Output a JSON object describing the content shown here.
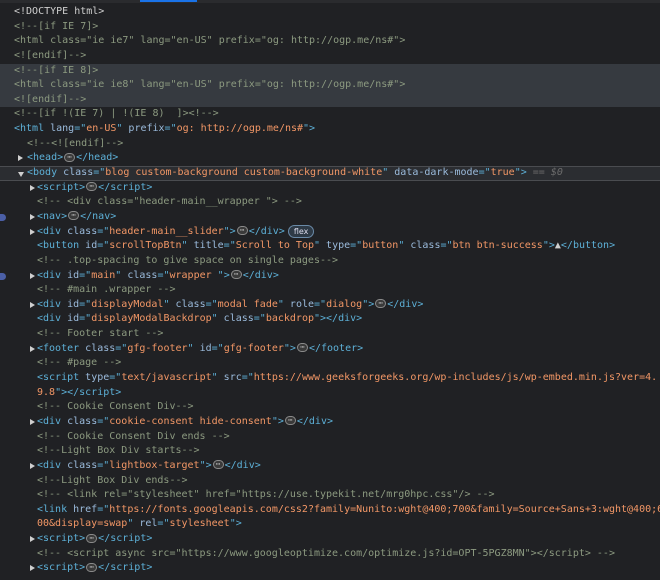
{
  "devtools": {
    "panel": "Elements",
    "selected_suffix": "== $0",
    "rows": [
      {
        "indent": 0,
        "tokens": [
          [
            "tx",
            "<!DOCTYPE html>"
          ]
        ]
      },
      {
        "indent": 0,
        "tokens": [
          [
            "cm",
            "<!--[if IE 7]>"
          ]
        ]
      },
      {
        "indent": 0,
        "tokens": [
          [
            "cm",
            "<html class=\"ie ie7\" lang=\"en-US\" prefix=\"og: http://ogp.me/ns#\">"
          ]
        ]
      },
      {
        "indent": 0,
        "tokens": [
          [
            "cm",
            "<![endif]-->"
          ]
        ]
      },
      {
        "indent": 0,
        "hl": true,
        "tokens": [
          [
            "cm",
            "<!--[if IE 8]>"
          ]
        ]
      },
      {
        "indent": 0,
        "hl": true,
        "tokens": [
          [
            "cm",
            "<html class=\"ie ie8\" lang=\"en-US\" prefix=\"og: http://ogp.me/ns#\">"
          ]
        ]
      },
      {
        "indent": 0,
        "hl": true,
        "tokens": [
          [
            "cm",
            "<![endif]-->"
          ]
        ]
      },
      {
        "indent": 0,
        "tokens": [
          [
            "cm",
            "<!--[if !(IE 7) | !(IE 8)  ]><!-->"
          ]
        ]
      },
      {
        "indent": 0,
        "tokens": [
          [
            "tag",
            "<html "
          ],
          [
            "an",
            "lang"
          ],
          [
            "tag",
            "=\""
          ],
          [
            "av",
            "en-US"
          ],
          [
            "tag",
            "\" "
          ],
          [
            "an",
            "prefix"
          ],
          [
            "tag",
            "=\""
          ],
          [
            "av",
            "og: http://ogp.me/ns#"
          ],
          [
            "tag",
            "\">"
          ]
        ]
      },
      {
        "indent": 1,
        "tokens": [
          [
            "cm",
            "<!--<![endif]-->"
          ]
        ]
      },
      {
        "indent": 1,
        "arrow": "closed",
        "tokens": [
          [
            "tag",
            "<head>"
          ],
          [
            "ell",
            ""
          ],
          [
            "tag",
            "</head>"
          ]
        ]
      },
      {
        "indent": 1,
        "arrow": "open",
        "sel": true,
        "tokens": [
          [
            "tag",
            "<body "
          ],
          [
            "an",
            "class"
          ],
          [
            "tag",
            "=\""
          ],
          [
            "av",
            "blog custom-background custom-background-white"
          ],
          [
            "tag",
            "\" "
          ],
          [
            "an",
            "data-dark-mode"
          ],
          [
            "tag",
            "=\""
          ],
          [
            "av",
            "true"
          ],
          [
            "tag",
            "\">"
          ],
          [
            "dim",
            " == $0"
          ]
        ]
      },
      {
        "indent": 2,
        "arrow": "closed",
        "tokens": [
          [
            "tag",
            "<script>"
          ],
          [
            "ell",
            ""
          ],
          [
            "tag",
            "</script>"
          ]
        ]
      },
      {
        "indent": 2,
        "tokens": [
          [
            "cm",
            "<!-- <div class=\"header-main__wrapper \"> -->"
          ]
        ]
      },
      {
        "indent": 2,
        "arrow": "closed",
        "bp": true,
        "tokens": [
          [
            "tag",
            "<nav>"
          ],
          [
            "ell",
            ""
          ],
          [
            "tag",
            "</nav>"
          ]
        ]
      },
      {
        "indent": 2,
        "arrow": "closed",
        "tokens": [
          [
            "tag",
            "<div "
          ],
          [
            "an",
            "class"
          ],
          [
            "tag",
            "=\""
          ],
          [
            "av",
            "header-main__slider"
          ],
          [
            "tag",
            "\">"
          ],
          [
            "ell",
            ""
          ],
          [
            "tag",
            "</div>"
          ],
          [
            "badge",
            "flex"
          ]
        ]
      },
      {
        "indent": 2,
        "tokens": [
          [
            "tag",
            "<button "
          ],
          [
            "an",
            "id"
          ],
          [
            "tag",
            "=\""
          ],
          [
            "av",
            "scrollTopBtn"
          ],
          [
            "tag",
            "\" "
          ],
          [
            "an",
            "title"
          ],
          [
            "tag",
            "=\""
          ],
          [
            "av",
            "Scroll to Top"
          ],
          [
            "tag",
            "\" "
          ],
          [
            "an",
            "type"
          ],
          [
            "tag",
            "=\""
          ],
          [
            "av",
            "button"
          ],
          [
            "tag",
            "\" "
          ],
          [
            "an",
            "class"
          ],
          [
            "tag",
            "=\""
          ],
          [
            "av",
            "btn btn-success"
          ],
          [
            "tag",
            "\">"
          ],
          [
            "tx",
            "▲"
          ],
          [
            "tag",
            "</button>"
          ]
        ]
      },
      {
        "indent": 2,
        "tokens": [
          [
            "cm",
            "<!-- .top-spacing to give space on single pages-->"
          ]
        ]
      },
      {
        "indent": 2,
        "arrow": "closed",
        "bp": true,
        "tokens": [
          [
            "tag",
            "<div "
          ],
          [
            "an",
            "id"
          ],
          [
            "tag",
            "=\""
          ],
          [
            "av",
            "main"
          ],
          [
            "tag",
            "\" "
          ],
          [
            "an",
            "class"
          ],
          [
            "tag",
            "=\""
          ],
          [
            "av",
            "wrapper "
          ],
          [
            "tag",
            "\">"
          ],
          [
            "ell",
            ""
          ],
          [
            "tag",
            "</div>"
          ]
        ]
      },
      {
        "indent": 2,
        "tokens": [
          [
            "cm",
            "<!-- #main .wrapper -->"
          ]
        ]
      },
      {
        "indent": 2,
        "arrow": "closed",
        "tokens": [
          [
            "tag",
            "<div "
          ],
          [
            "an",
            "id"
          ],
          [
            "tag",
            "=\""
          ],
          [
            "av",
            "displayModal"
          ],
          [
            "tag",
            "\" "
          ],
          [
            "an",
            "class"
          ],
          [
            "tag",
            "=\""
          ],
          [
            "av",
            "modal fade"
          ],
          [
            "tag",
            "\" "
          ],
          [
            "an",
            "role"
          ],
          [
            "tag",
            "=\""
          ],
          [
            "av",
            "dialog"
          ],
          [
            "tag",
            "\">"
          ],
          [
            "ell",
            ""
          ],
          [
            "tag",
            "</div>"
          ]
        ]
      },
      {
        "indent": 2,
        "tokens": [
          [
            "tag",
            "<div "
          ],
          [
            "an",
            "id"
          ],
          [
            "tag",
            "=\""
          ],
          [
            "av",
            "displayModalBackdrop"
          ],
          [
            "tag",
            "\" "
          ],
          [
            "an",
            "class"
          ],
          [
            "tag",
            "=\""
          ],
          [
            "av",
            "backdrop"
          ],
          [
            "tag",
            "\"></div>"
          ]
        ]
      },
      {
        "indent": 2,
        "tokens": [
          [
            "cm",
            "<!-- Footer start -->"
          ]
        ]
      },
      {
        "indent": 2,
        "arrow": "closed",
        "tokens": [
          [
            "tag",
            "<footer "
          ],
          [
            "an",
            "class"
          ],
          [
            "tag",
            "=\""
          ],
          [
            "av",
            "gfg-footer"
          ],
          [
            "tag",
            "\" "
          ],
          [
            "an",
            "id"
          ],
          [
            "tag",
            "=\""
          ],
          [
            "av",
            "gfg-footer"
          ],
          [
            "tag",
            "\">"
          ],
          [
            "ell",
            ""
          ],
          [
            "tag",
            "</footer>"
          ]
        ]
      },
      {
        "indent": 2,
        "tokens": [
          [
            "cm",
            "<!-- #page -->"
          ]
        ]
      },
      {
        "indent": 2,
        "tokens": [
          [
            "tag",
            "<script "
          ],
          [
            "an",
            "type"
          ],
          [
            "tag",
            "=\""
          ],
          [
            "av",
            "text/javascript"
          ],
          [
            "tag",
            "\" "
          ],
          [
            "an",
            "src"
          ],
          [
            "tag",
            "=\""
          ],
          [
            "av",
            "https://www.geeksforgeeks.org/wp-includes/js/wp-embed.min.js?ver=4."
          ]
        ]
      },
      {
        "indent": 2,
        "tokens": [
          [
            "av",
            "9.8"
          ],
          [
            "tag",
            "\"></script>"
          ]
        ]
      },
      {
        "indent": 2,
        "tokens": [
          [
            "cm",
            "<!-- Cookie Consent Div-->"
          ]
        ]
      },
      {
        "indent": 2,
        "arrow": "closed",
        "tokens": [
          [
            "tag",
            "<div "
          ],
          [
            "an",
            "class"
          ],
          [
            "tag",
            "=\""
          ],
          [
            "av",
            "cookie-consent hide-consent"
          ],
          [
            "tag",
            "\">"
          ],
          [
            "ell",
            ""
          ],
          [
            "tag",
            "</div>"
          ]
        ]
      },
      {
        "indent": 2,
        "tokens": [
          [
            "cm",
            "<!-- Cookie Consent Div ends -->"
          ]
        ]
      },
      {
        "indent": 2,
        "tokens": [
          [
            "cm",
            "<!--Light Box Div starts-->"
          ]
        ]
      },
      {
        "indent": 2,
        "arrow": "closed",
        "tokens": [
          [
            "tag",
            "<div "
          ],
          [
            "an",
            "class"
          ],
          [
            "tag",
            "=\""
          ],
          [
            "av",
            "lightbox-target"
          ],
          [
            "tag",
            "\">"
          ],
          [
            "ell",
            ""
          ],
          [
            "tag",
            "</div>"
          ]
        ]
      },
      {
        "indent": 2,
        "tokens": [
          [
            "cm",
            "<!--Light Box Div ends-->"
          ]
        ]
      },
      {
        "indent": 2,
        "tokens": [
          [
            "cm",
            "<!-- <link rel=\"stylesheet\" href=\"https://use.typekit.net/mrg0hpc.css\"/> -->"
          ]
        ]
      },
      {
        "indent": 2,
        "tokens": [
          [
            "tag",
            "<link "
          ],
          [
            "an",
            "href"
          ],
          [
            "tag",
            "=\""
          ],
          [
            "av",
            "https://fonts.googleapis.com/css2?family=Nunito:wght@400;700&family=Source+Sans+3:wght@400;6"
          ]
        ]
      },
      {
        "indent": 2,
        "tokens": [
          [
            "av",
            "00&display=swap"
          ],
          [
            "tag",
            "\" "
          ],
          [
            "an",
            "rel"
          ],
          [
            "tag",
            "=\""
          ],
          [
            "av",
            "stylesheet"
          ],
          [
            "tag",
            "\">"
          ]
        ]
      },
      {
        "indent": 2,
        "arrow": "closed",
        "tokens": [
          [
            "tag",
            "<script>"
          ],
          [
            "ell",
            ""
          ],
          [
            "tag",
            "</script>"
          ]
        ]
      },
      {
        "indent": 2,
        "tokens": [
          [
            "cm",
            "<!-- <script async src=\"https://www.googleoptimize.com/optimize.js?id=OPT-5PGZ8MN\"></script> -->"
          ]
        ]
      },
      {
        "indent": 2,
        "arrow": "closed",
        "tokens": [
          [
            "tag",
            "<script>"
          ],
          [
            "ell",
            ""
          ],
          [
            "tag",
            "</script>"
          ]
        ]
      }
    ]
  }
}
